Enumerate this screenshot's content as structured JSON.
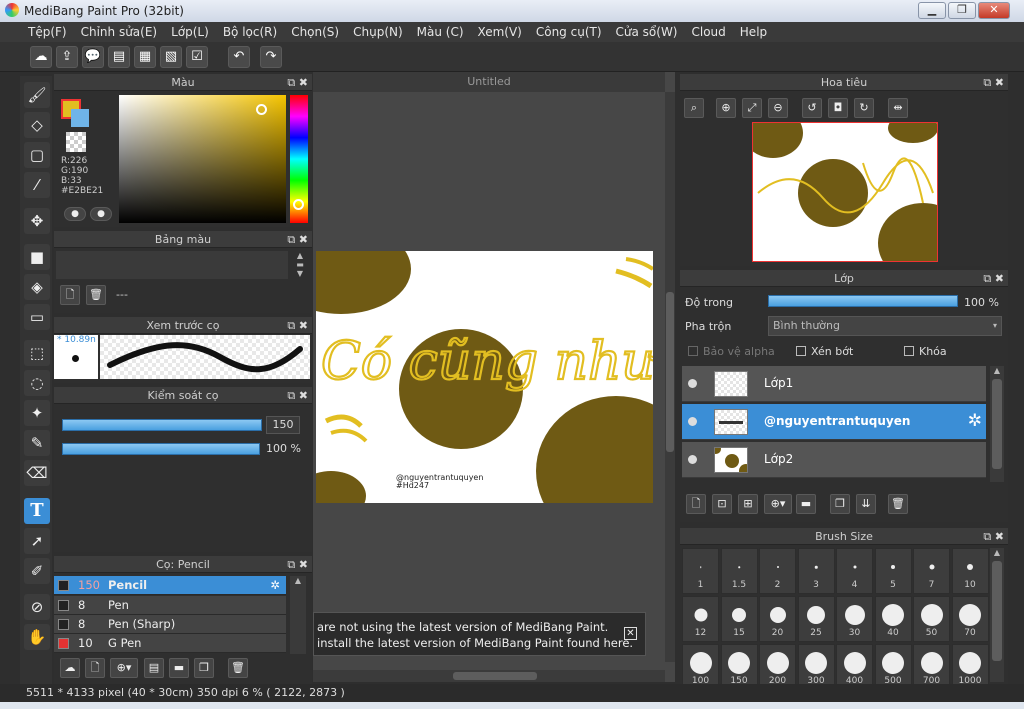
{
  "window": {
    "title": "MediBang Paint Pro (32bit)"
  },
  "menu": [
    "Tệp(F)",
    "Chỉnh sửa(E)",
    "Lớp(L)",
    "Bộ lọc(R)",
    "Chọn(S)",
    "Chụp(N)",
    "Màu (C)",
    "Xem(V)",
    "Công cụ(T)",
    "Cửa sổ(W)",
    "Cloud",
    "Help"
  ],
  "color_panel": {
    "title": "Màu",
    "r": "R:226",
    "g": "G:190",
    "b": "B:33",
    "hex": "#E2BE21",
    "fg": "#e2be21",
    "bg": "#6fb4e8"
  },
  "palette_panel": {
    "title": "Bảng màu",
    "dash": "---"
  },
  "brush_preview": {
    "title": "Xem trước cọ",
    "size": "* 10.89n"
  },
  "brush_control": {
    "title": "Kiểm soát cọ",
    "size_value": "150",
    "opacity_value": "100 %"
  },
  "brush_list": {
    "title": "Cọ: Pencil",
    "items": [
      {
        "size": "150",
        "name": "Pencil",
        "color": "#222222",
        "selected": true
      },
      {
        "size": "8",
        "name": "Pen",
        "color": "#222222",
        "selected": false
      },
      {
        "size": "8",
        "name": "Pen (Sharp)",
        "color": "#222222",
        "selected": false
      },
      {
        "size": "10",
        "name": "G Pen",
        "color": "#e33333",
        "selected": false
      }
    ]
  },
  "canvas": {
    "tab": "Untitled",
    "art_text": "Có cũng như không",
    "watermark1": "@nguyentrantuquyen",
    "watermark2": "#Hd247"
  },
  "notice": {
    "line1": "are not using the latest version of MediBang Paint.",
    "line2": "install the latest version of MediBang Paint found here."
  },
  "navigator": {
    "title": "Hoa tiêu"
  },
  "layers": {
    "title": "Lớp",
    "opacity_label": "Độ trong",
    "opacity_value": "100 %",
    "opacity": 1.0,
    "blend_label": "Pha trộn",
    "blend_value": "Bình thường",
    "protect_alpha": "Bảo vệ alpha",
    "clip": "Xén bớt",
    "lock": "Khóa",
    "items": [
      {
        "name": "Lớp1",
        "selected": false
      },
      {
        "name": "@nguyentrantuquyen",
        "selected": true
      },
      {
        "name": "Lớp2",
        "selected": false
      }
    ]
  },
  "brush_size": {
    "title": "Brush Size",
    "sizes": [
      "1",
      "1.5",
      "2",
      "3",
      "4",
      "5",
      "7",
      "10",
      "12",
      "15",
      "20",
      "25",
      "30",
      "40",
      "50",
      "70",
      "100",
      "150",
      "200",
      "300",
      "400",
      "500",
      "700",
      "1000"
    ]
  },
  "status": {
    "text": "5511 * 4133 pixel  (40 * 30cm)  350 dpi  6 %  ( 2122, 2873 )"
  }
}
